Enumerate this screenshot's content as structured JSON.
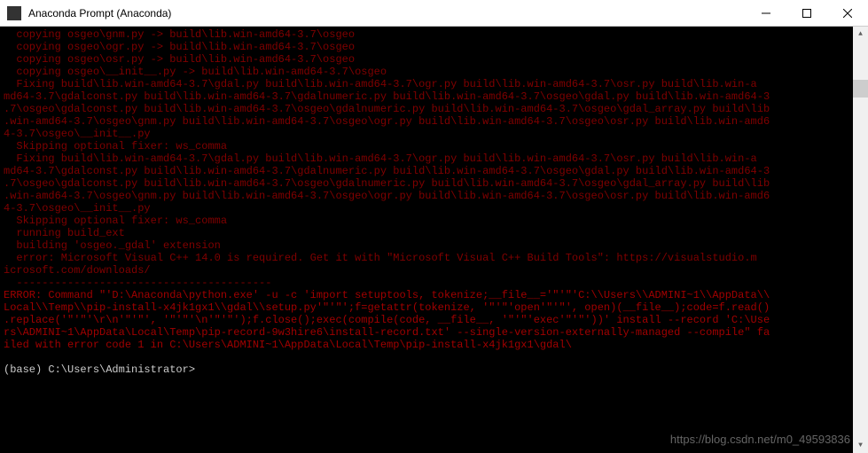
{
  "window": {
    "title": "Anaconda Prompt (Anaconda)"
  },
  "console": {
    "line1": "  copying osgeo\\gnm.py -> build\\lib.win-amd64-3.7\\osgeo",
    "line2": "  copying osgeo\\ogr.py -> build\\lib.win-amd64-3.7\\osgeo",
    "line3": "  copying osgeo\\osr.py -> build\\lib.win-amd64-3.7\\osgeo",
    "line4": "  copying osgeo\\__init__.py -> build\\lib.win-amd64-3.7\\osgeo",
    "line5": "  Fixing build\\lib.win-amd64-3.7\\gdal.py build\\lib.win-amd64-3.7\\ogr.py build\\lib.win-amd64-3.7\\osr.py build\\lib.win-a",
    "line6": "md64-3.7\\gdalconst.py build\\lib.win-amd64-3.7\\gdalnumeric.py build\\lib.win-amd64-3.7\\osgeo\\gdal.py build\\lib.win-amd64-3",
    "line7": ".7\\osgeo\\gdalconst.py build\\lib.win-amd64-3.7\\osgeo\\gdalnumeric.py build\\lib.win-amd64-3.7\\osgeo\\gdal_array.py build\\lib",
    "line8": ".win-amd64-3.7\\osgeo\\gnm.py build\\lib.win-amd64-3.7\\osgeo\\ogr.py build\\lib.win-amd64-3.7\\osgeo\\osr.py build\\lib.win-amd6",
    "line9": "4-3.7\\osgeo\\__init__.py",
    "line10": "  Skipping optional fixer: ws_comma",
    "line11": "  Fixing build\\lib.win-amd64-3.7\\gdal.py build\\lib.win-amd64-3.7\\ogr.py build\\lib.win-amd64-3.7\\osr.py build\\lib.win-a",
    "line12": "md64-3.7\\gdalconst.py build\\lib.win-amd64-3.7\\gdalnumeric.py build\\lib.win-amd64-3.7\\osgeo\\gdal.py build\\lib.win-amd64-3",
    "line13": ".7\\osgeo\\gdalconst.py build\\lib.win-amd64-3.7\\osgeo\\gdalnumeric.py build\\lib.win-amd64-3.7\\osgeo\\gdal_array.py build\\lib",
    "line14": ".win-amd64-3.7\\osgeo\\gnm.py build\\lib.win-amd64-3.7\\osgeo\\ogr.py build\\lib.win-amd64-3.7\\osgeo\\osr.py build\\lib.win-amd6",
    "line15": "4-3.7\\osgeo\\__init__.py",
    "line16": "  Skipping optional fixer: ws_comma",
    "line17": "  running build_ext",
    "line18": "  building 'osgeo._gdal' extension",
    "line19": "  error: Microsoft Visual C++ 14.0 is required. Get it with \"Microsoft Visual C++ Build Tools\": https://visualstudio.m",
    "line20": "icrosoft.com/downloads/",
    "line21": "  ----------------------------------------",
    "line22": "ERROR: Command \"'D:\\Anaconda\\python.exe' -u -c 'import setuptools, tokenize;__file__='\"'\"'C:\\\\Users\\\\ADMINI~1\\\\AppData\\\\",
    "line23": "Local\\\\Temp\\\\pip-install-x4jk1gx1\\\\gdal\\\\setup.py'\"'\"';f=getattr(tokenize, '\"'\"'open'\"'\"', open)(__file__);code=f.read()",
    "line24": ".replace('\"'\"'\\r\\n'\"'\"', '\"'\"'\\n'\"'\"');f.close();exec(compile(code, __file__, '\"'\"'exec'\"'\"'))' install --record 'C:\\Use",
    "line25": "rs\\ADMINI~1\\AppData\\Local\\Temp\\pip-record-9w3hire6\\install-record.txt' --single-version-externally-managed --compile\" fa",
    "line26": "iled with error code 1 in C:\\Users\\ADMINI~1\\AppData\\Local\\Temp\\pip-install-x4jk1gx1\\gdal\\",
    "prompt": "(base) C:\\Users\\Administrator>"
  },
  "watermark": "https://blog.csdn.net/m0_49593836"
}
